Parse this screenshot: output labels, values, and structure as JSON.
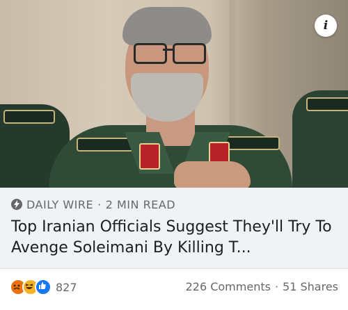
{
  "post": {
    "image_alt": "Photo of a gray-bearded man in a green military uniform",
    "info_icon": "i",
    "source": "DAILY WIRE",
    "separator": "·",
    "read_time": "2 MIN READ",
    "headline": "Top Iranian Officials Suggest They'll Try To Avenge Soleimani By Killing T...",
    "reactions": {
      "icons": [
        "angry-reaction-icon",
        "haha-reaction-icon",
        "like-reaction-icon"
      ],
      "count": "827"
    },
    "comments": "226 Comments",
    "shares": "51 Shares"
  },
  "colors": {
    "meta_bg": "#f0f2f5",
    "muted_text": "#65676b",
    "headline_text": "#1c1e21",
    "like_blue": "#1877f2"
  }
}
